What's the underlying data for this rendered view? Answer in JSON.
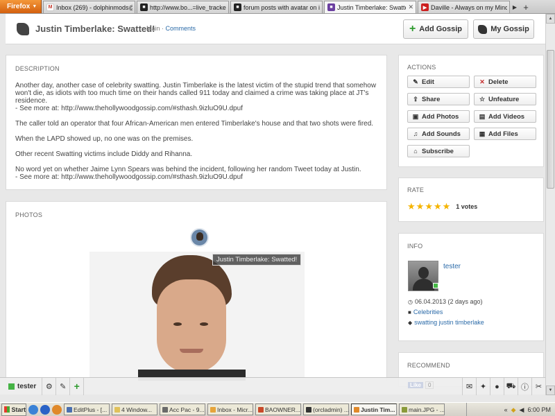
{
  "browser": {
    "menu_label": "Firefox",
    "tabs": [
      {
        "title": "Inbox (269) - dolphinmods@...",
        "icon": "gmail-icon",
        "color": "#c5372c",
        "active": false
      },
      {
        "title": "http://www.bo...=live_tracker",
        "icon": "site-icon",
        "color": "#222222",
        "active": false
      },
      {
        "title": "forum posts with avatar on in...",
        "icon": "site-icon",
        "color": "#222222",
        "active": false
      },
      {
        "title": "Justin Timberlake: Swatted!",
        "icon": "site-icon",
        "color": "#6b3fa0",
        "active": true
      },
      {
        "title": "Daville - Always on my Mind -...",
        "icon": "youtube-icon",
        "color": "#cc1f1f",
        "active": false
      }
    ]
  },
  "header": {
    "title": "Justin Timberlake: Swatted!",
    "nav_main": "Main",
    "nav_separator": "·",
    "nav_comments": "Comments",
    "add_button": "Add Gossip",
    "my_button": "My Gossip"
  },
  "description": {
    "heading": "DESCRIPTION",
    "paragraphs": [
      "Another day, another case of celebrity swatting. Justin Timberlake is the latest victim of the stupid trend that somehow won't die, as idiots with too much time on their hands called 911 today and claimed a crime was taking place at JT's residence.",
      "- See more at: http://www.thehollywoodgossip.com/#sthash.9izluO9U.dpuf",
      "The caller told an operator that four African-American men entered Timberlake's house and that two shots were fired.",
      "When the LAPD showed up, no one was on the premises.",
      "Other recent Swatting victims include Diddy and Rihanna.",
      "No word yet on whether Jaime Lynn Spears was behind the incident, following her random Tweet today at Justin.",
      "- See more at: http://www.thehollywoodgossip.com/#sthash.9izluO9U.dpuf"
    ]
  },
  "photos": {
    "heading": "PHOTOS",
    "tooltip": "Justin Timberlake: Swatted!"
  },
  "actions": {
    "heading": "ACTIONS",
    "buttons": [
      {
        "label": "Edit",
        "icon": "edit-icon"
      },
      {
        "label": "Delete",
        "icon": "delete-icon"
      },
      {
        "label": "Share",
        "icon": "share-icon"
      },
      {
        "label": "Unfeature",
        "icon": "star-icon"
      },
      {
        "label": "Add Photos",
        "icon": "photo-icon"
      },
      {
        "label": "Add Videos",
        "icon": "film-icon"
      },
      {
        "label": "Add Sounds",
        "icon": "music-icon"
      },
      {
        "label": "Add Files",
        "icon": "file-icon"
      },
      {
        "label": "Subscribe",
        "icon": "tag-icon"
      }
    ]
  },
  "rate": {
    "heading": "RATE",
    "stars": 5,
    "votes": "1 votes"
  },
  "info": {
    "heading": "INFO",
    "user": "tester",
    "date": "06.04.2013 (2 days ago)",
    "category": "Celebrities",
    "tags": "swatting justin timberlake"
  },
  "recommend": {
    "heading": "RECOMMEND"
  },
  "bottombar": {
    "user": "tester",
    "like_label": "Like",
    "like_count": "0"
  },
  "taskbar": {
    "start": "Start",
    "tasks": [
      {
        "label": "EditPlus - [...",
        "active": false
      },
      {
        "label": "4 Window...",
        "active": false
      },
      {
        "label": "Acc Pac - 9....",
        "active": false
      },
      {
        "label": "Inbox - Micr...",
        "active": false
      },
      {
        "label": "BAOWNER...",
        "active": false
      },
      {
        "label": "(orcladmin) ...",
        "active": false
      },
      {
        "label": "Justin Tim...",
        "active": true
      },
      {
        "label": "main.JPG - ...",
        "active": false
      }
    ],
    "clock": "6:00 PM"
  },
  "colors": {
    "link": "#2a6aa8",
    "star": "#f5b400",
    "online": "#46b946",
    "add_green": "#2c9a2c"
  }
}
